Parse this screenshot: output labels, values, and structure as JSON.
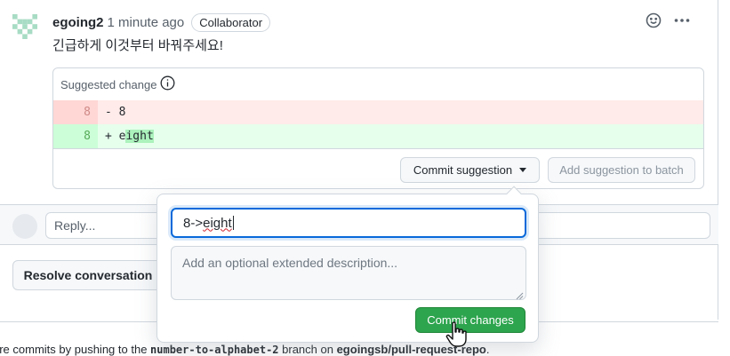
{
  "comment": {
    "author": "egoing2",
    "time": "1 minute ago",
    "badge": "Collaborator",
    "body": "긴급하게 이것부터 바꿔주세요!",
    "header_icons": [
      "smiley-icon",
      "kebab-horizontal-icon"
    ]
  },
  "suggestion": {
    "title": "Suggested change",
    "info_icon": "info-icon",
    "lines": [
      {
        "type": "deletion",
        "line_number": "8",
        "sign": "-",
        "text": "8"
      },
      {
        "type": "addition",
        "line_number": "8",
        "sign": "+",
        "text_prefix": "e",
        "text_highlight": "ight"
      }
    ],
    "commit_button": "Commit suggestion",
    "batch_button": "Add suggestion to batch"
  },
  "reply": {
    "placeholder": "Reply..."
  },
  "resolve_button": "Resolve conversation",
  "commit_popover": {
    "message": "8->eight",
    "message_prefix": "8->",
    "message_misspelled": "eight",
    "description_placeholder": "Add an optional extended description...",
    "commit_button": "Commit changes"
  },
  "footer": {
    "text_before": "ore commits by pushing to the ",
    "branch": "number-to-alphabet-2",
    "text_middle": " branch on ",
    "repo": "egoingsb/pull-request-repo",
    "text_after": "."
  },
  "colors": {
    "accent_blue": "#0969da",
    "commit_green": "#2da44e",
    "deletion_bg": "#ffebe9",
    "addition_bg": "#e6ffec",
    "addition_highlight": "#abf2bc"
  }
}
